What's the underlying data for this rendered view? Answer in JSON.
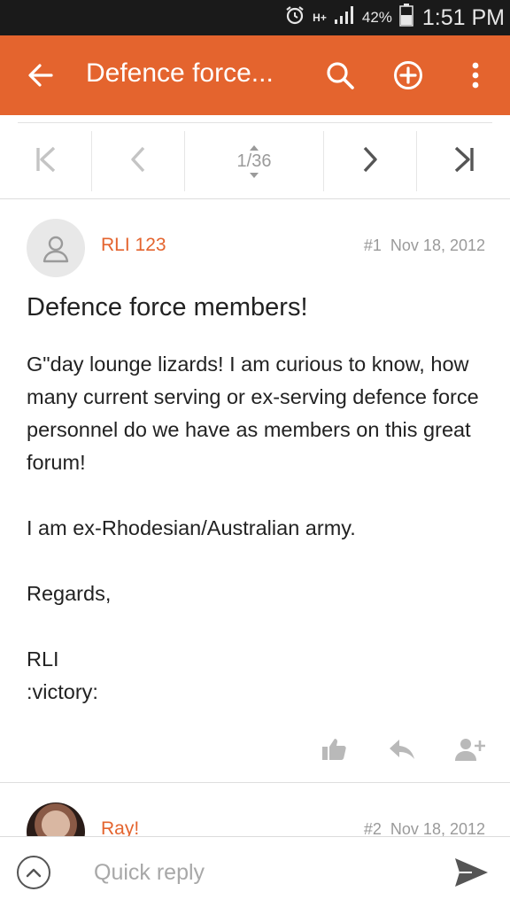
{
  "status_bar": {
    "network": "H+",
    "battery_percent": "42%",
    "time": "1:51 PM",
    "icons": [
      "alarm-icon",
      "network-h-plus-icon",
      "signal-icon",
      "battery-icon"
    ]
  },
  "app_bar": {
    "title": "Defence force...",
    "background": "#e4642e",
    "icons": [
      "back-arrow-icon",
      "search-icon",
      "add-circle-icon",
      "overflow-menu-icon"
    ]
  },
  "pager": {
    "current_page": 1,
    "total_pages": 36,
    "label_current": "1",
    "label_total": "36",
    "icons": [
      "first-page-icon",
      "previous-page-icon",
      "next-page-icon",
      "last-page-icon"
    ]
  },
  "posts": [
    {
      "username": "RLI 123",
      "number": "#1",
      "date": "Nov 18, 2012",
      "title": "Defence force members!",
      "body": [
        "G\"day lounge lizards! I am curious to know, how many current serving or ex-serving defence force personnel do we have as members on this great forum!",
        "I am ex-Rhodesian/Australian army.",
        "Regards,",
        "RLI",
        ":victory:"
      ],
      "actions": [
        "like-icon",
        "reply-icon",
        "follow-user-icon"
      ]
    },
    {
      "username": "Ray!",
      "number": "#2",
      "date": "Nov 18, 2012"
    }
  ],
  "quick_reply": {
    "placeholder": "Quick reply",
    "value": ""
  },
  "colors": {
    "accent": "#e4642e",
    "status_bar": "#1a1a1a",
    "muted_text": "#9a9a9a"
  }
}
